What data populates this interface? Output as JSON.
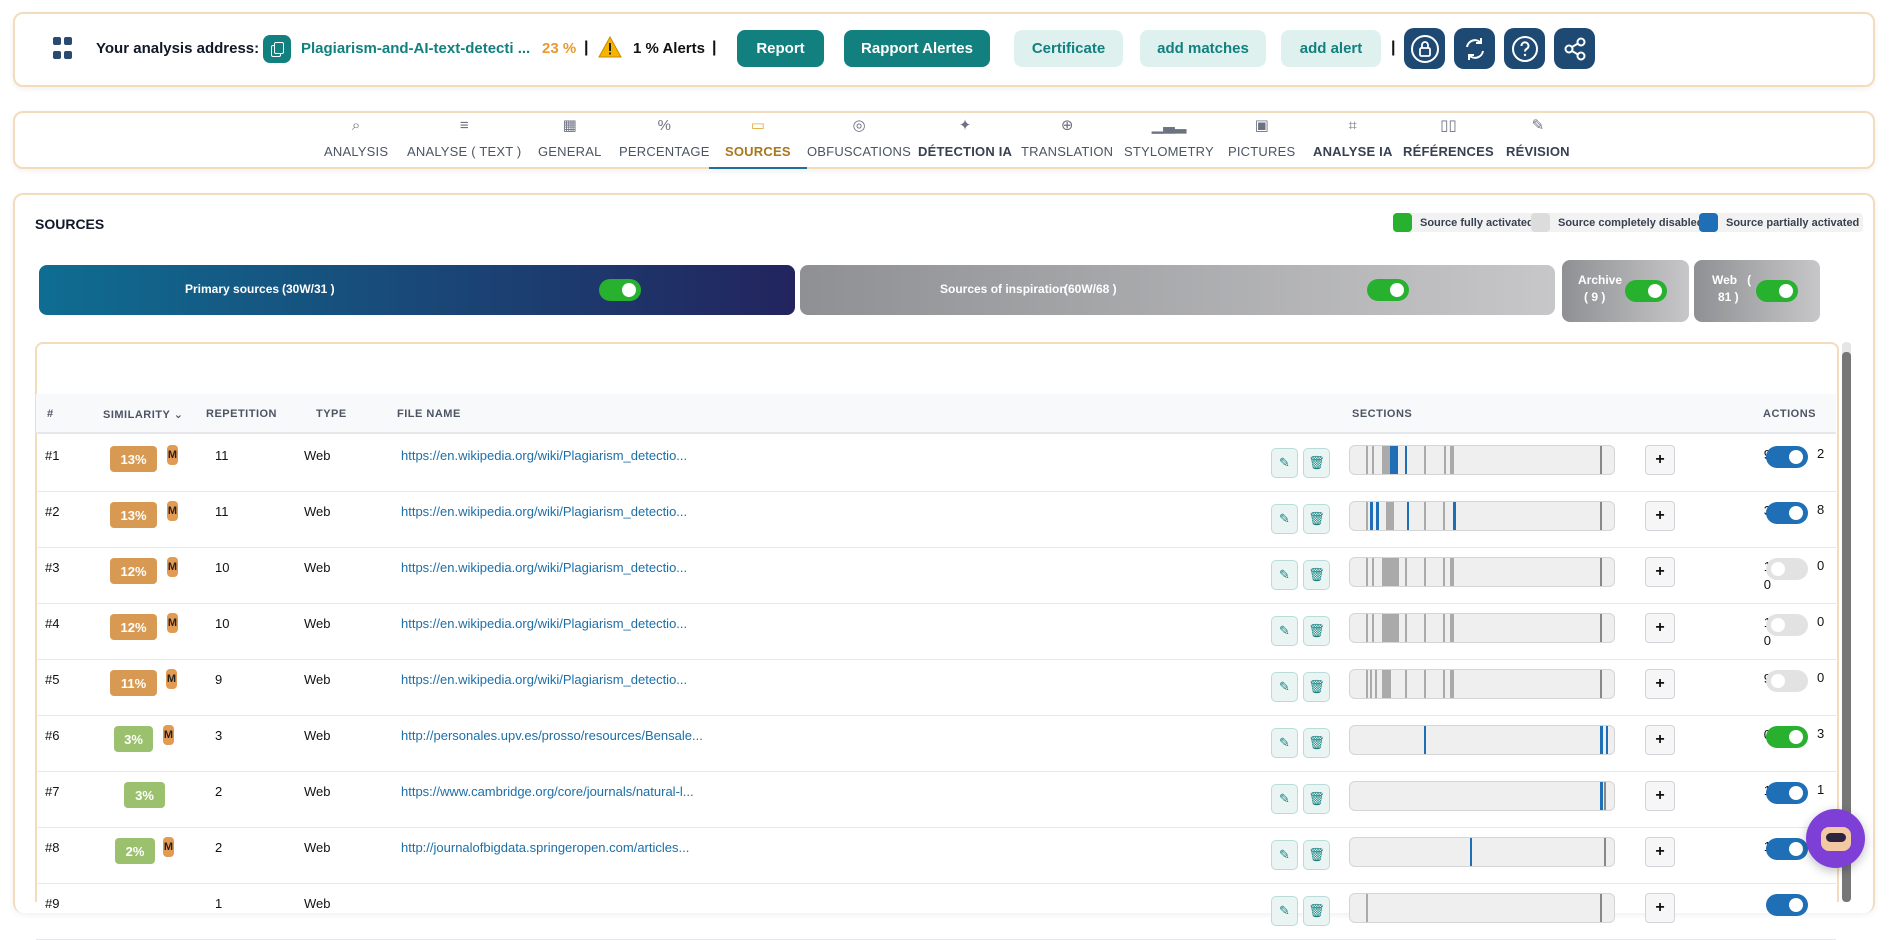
{
  "topbar": {
    "address_label": "Your analysis address:",
    "address_value": "Plagiarism-and-AI-text-detecti ...",
    "percentage": "23 %",
    "separator": "|",
    "alerts": "1 % Alerts",
    "buttons": {
      "report": "Report",
      "rapport_alertes": "Rapport Alertes",
      "certificate": "Certificate",
      "add_matches": "add matches",
      "add_alert": "add alert"
    }
  },
  "tabs": [
    {
      "label": "ANALYSIS",
      "icon": "search-icon"
    },
    {
      "label": "ANALYSE ( TEXT )",
      "icon": "text-lines-icon"
    },
    {
      "label": "GENERAL",
      "icon": "grid-icon"
    },
    {
      "label": "PERCENTAGE",
      "icon": "percent-icon"
    },
    {
      "label": "SOURCES",
      "icon": "folder-icon",
      "active": true
    },
    {
      "label": "OBFUSCATIONS",
      "icon": "eye-slash-icon"
    },
    {
      "label": "DÉTECTION IA",
      "icon": "sparkle-icon"
    },
    {
      "label": "TRANSLATION",
      "icon": "globe-icon"
    },
    {
      "label": "STYLOMETRY",
      "icon": "bar-chart-icon"
    },
    {
      "label": "PICTURES",
      "icon": "image-icon"
    },
    {
      "label": "ANALYSE IA",
      "icon": "chip-icon"
    },
    {
      "label": "RÉFÉRENCES",
      "icon": "book-icon"
    },
    {
      "label": "RÉVISION",
      "icon": "pencil-icon"
    }
  ],
  "sources": {
    "title": "SOURCES",
    "legend": {
      "full": "Source fully activated",
      "disabled": "Source completely disabled",
      "partial": "Source partially activated"
    },
    "groups": {
      "primary": "Primary sources",
      "primary_count": "(30W/31 )",
      "inspiration": "Sources of inspiration",
      "inspiration_count": "(60W/68 )",
      "archive": "Archive",
      "archive_count": "( 9 )",
      "web": "Web   (",
      "web_count": "81 )"
    }
  },
  "table": {
    "headers": {
      "num": "#",
      "similarity": "SIMILARITY",
      "repetition": "REPETITION",
      "type": "TYPE",
      "file_name": "FILE NAME",
      "sections": "SECTIONS",
      "actions": "ACTIONS"
    },
    "rows": [
      {
        "num": "#1",
        "sim": "13%",
        "m": "M",
        "rep": "11",
        "type": "Web",
        "url": "https://en.wikipedia.org/wiki/Plagiarism_detectio...",
        "left": "9",
        "right": "2",
        "state": "partial",
        "color": "#d89a52"
      },
      {
        "num": "#2",
        "sim": "13%",
        "m": "M",
        "rep": "11",
        "type": "Web",
        "url": "https://en.wikipedia.org/wiki/Plagiarism_detectio...",
        "left": "3",
        "right": "8",
        "state": "partial",
        "color": "#d89a52"
      },
      {
        "num": "#3",
        "sim": "12%",
        "m": "M",
        "rep": "10",
        "type": "Web",
        "url": "https://en.wikipedia.org/wiki/Plagiarism_detectio...",
        "left": "1\n0",
        "right": "0",
        "state": "off",
        "color": "#d89a52"
      },
      {
        "num": "#4",
        "sim": "12%",
        "m": "M",
        "rep": "10",
        "type": "Web",
        "url": "https://en.wikipedia.org/wiki/Plagiarism_detectio...",
        "left": "1\n0",
        "right": "0",
        "state": "off",
        "color": "#d89a52"
      },
      {
        "num": "#5",
        "sim": "11%",
        "m": "M",
        "rep": "9",
        "type": "Web",
        "url": "https://en.wikipedia.org/wiki/Plagiarism_detectio...",
        "left": "9",
        "right": "0",
        "state": "off",
        "color": "#d89a52"
      },
      {
        "num": "#6",
        "sim": "3%",
        "m": "M",
        "rep": "3",
        "type": "Web",
        "url": "http://personales.upv.es/prosso/resources/Bensale...",
        "left": "0",
        "right": "3",
        "state": "on",
        "color": "#9bc16e"
      },
      {
        "num": "#7",
        "sim": "3%",
        "m": "",
        "rep": "2",
        "type": "Web",
        "url": "https://www.cambridge.org/core/journals/natural-l...",
        "left": "1",
        "right": "1",
        "state": "partial",
        "color": "#9bc16e"
      },
      {
        "num": "#8",
        "sim": "2%",
        "m": "M",
        "rep": "2",
        "type": "Web",
        "url": "http://journalofbigdata.springeropen.com/articles...",
        "left": "1",
        "right": "",
        "state": "partial",
        "color": "#9bc16e"
      },
      {
        "num": "#9",
        "sim": "",
        "m": "",
        "rep": "1",
        "type": "Web",
        "url": "",
        "left": "",
        "right": "",
        "state": "partial",
        "color": "#9bc16e"
      }
    ]
  },
  "colors": {
    "teal": "#12807e",
    "navy": "#1d4972",
    "orange": "#d89a52",
    "green": "#27b12f",
    "blue": "#1e6fb5"
  }
}
